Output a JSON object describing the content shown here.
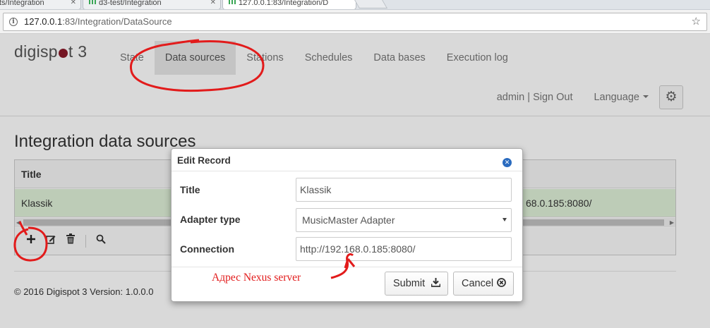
{
  "browser": {
    "tabs": [
      {
        "label": "ts/Integration",
        "active": false
      },
      {
        "label": "d3-test/Integration",
        "active": false
      },
      {
        "label": "127.0.0.1:83/Integration/D",
        "active": true
      }
    ],
    "url_host": "127.0.0.1",
    "url_path": ":83/Integration/DataSource"
  },
  "brand": {
    "part1": "digisp",
    "part2": "t 3",
    "dot_color": "#8a1a2a"
  },
  "nav": {
    "items": [
      "State",
      "Data sources",
      "Stations",
      "Schedules",
      "Data bases",
      "Execution log"
    ],
    "active_index": 1
  },
  "user": {
    "name": "admin",
    "separator": "|",
    "sign_out": "Sign Out",
    "language": "Language"
  },
  "page": {
    "heading": "Integration data sources"
  },
  "grid": {
    "columns": [
      "Title"
    ],
    "rows": [
      {
        "title": "Klassik",
        "connection_visible": "68.0.185:8080/"
      }
    ],
    "row_highlight_color": "#dff0d8"
  },
  "footer": {
    "text": "© 2016 Digispot 3 Version: 1.0.0.0"
  },
  "modal": {
    "title": "Edit Record",
    "fields": [
      {
        "label": "Title",
        "value": "Klassik"
      },
      {
        "label": "Adapter type",
        "value": "MusicMaster Adapter"
      },
      {
        "label": "Connection",
        "value": "http://192.168.0.185:8080/"
      }
    ],
    "submit_label": "Submit",
    "cancel_label": "Cancel"
  },
  "annotation": {
    "text": "Адрес Nexus server",
    "color": "#e21b1b"
  }
}
